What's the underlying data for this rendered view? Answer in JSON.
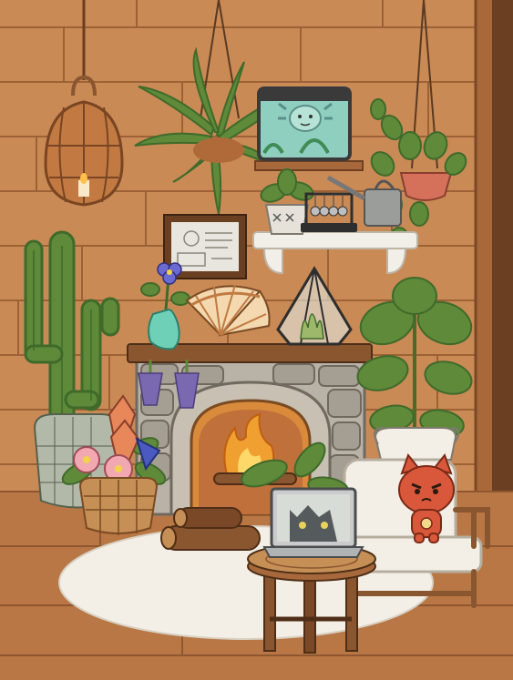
{
  "scene": {
    "colors": {
      "wall": "#c98a55",
      "wall_line": "#9c6236",
      "floor": "#b87744",
      "rug": "#f4efe6",
      "stone": "#b9b2a6",
      "stone_dark": "#8a8378",
      "wood_dark": "#8a5630",
      "plant_green": "#5f8a3a",
      "plant_dark": "#3f6a2a",
      "fire": "#f0a030",
      "fabric_white": "#f3efe6",
      "cat_red": "#d9573a",
      "laptop_gray": "#c9cbcc",
      "aquarium_water": "#8fcfc0"
    },
    "items": {
      "hanging_lantern": "lantern-icon",
      "hanging_fern": "fern-icon",
      "aquarium": "aquarium-icon",
      "axolotl": "axolotl-icon",
      "hanging_pothos": "pothos-icon",
      "framed_picture": "picture-frame-icon",
      "small_potted_plant": "potted-plant-icon",
      "newtons_cradle": "newtons-cradle-icon",
      "watering_can": "watering-can-icon",
      "violet_vase": "flower-vase-icon",
      "folding_fan": "fan-icon",
      "terrarium": "terrarium-icon",
      "cactus": "cactus-icon",
      "fiddle_leaf_fig": "fig-plant-icon",
      "fireplace": "fireplace-icon",
      "flower_basket": "flower-basket-icon",
      "firewood_logs": "firewood-icon",
      "rug": "rug-icon",
      "laptop": "laptop-icon",
      "laptop_cat_wallpaper": "cat-face-icon",
      "side_table": "stool-icon",
      "armchair": "armchair-icon",
      "red_cat_character": "cat-character-icon",
      "lavender_bundles": "lavender-icon",
      "window_frame": "window-frame-icon"
    }
  }
}
